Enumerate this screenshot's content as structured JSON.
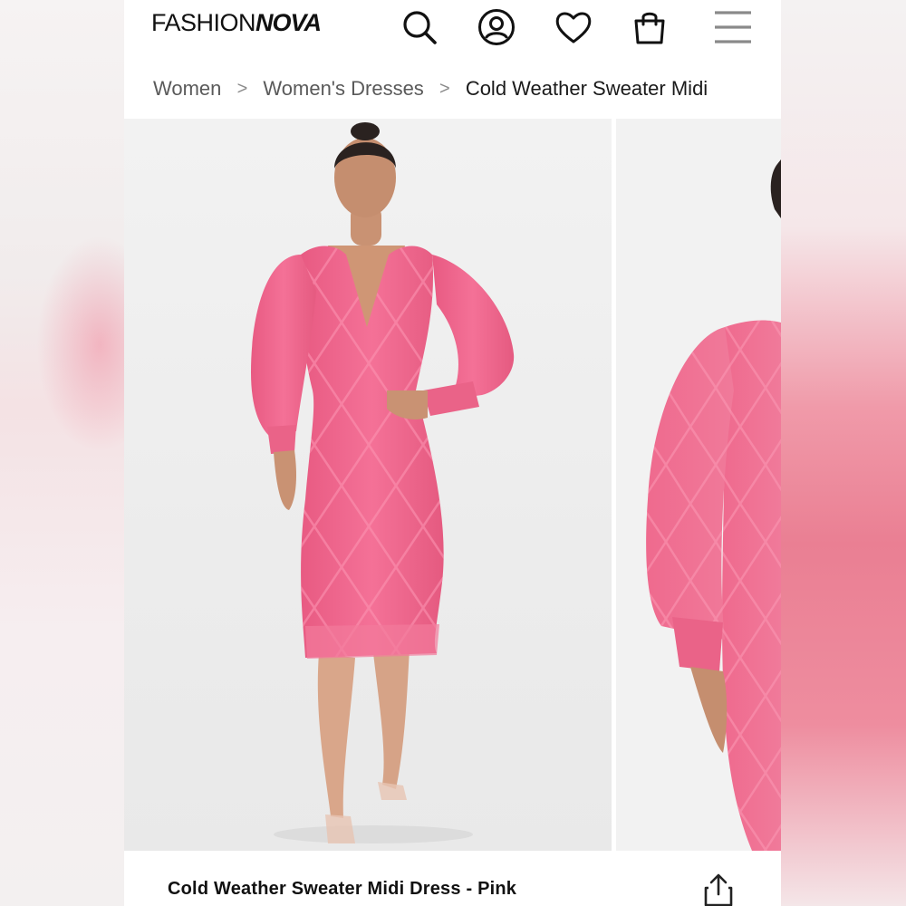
{
  "header": {
    "logo_light": "FASHION",
    "logo_bold": "NOVA",
    "icons": [
      "search-icon",
      "account-icon",
      "heart-icon",
      "bag-icon",
      "menu-icon"
    ]
  },
  "breadcrumb": {
    "items": [
      "Women",
      "Women's Dresses",
      "Cold Weather Sweater Midi"
    ],
    "separator": ">"
  },
  "product": {
    "title": "Cold Weather Sweater Midi Dress - Pink",
    "color": "#f06a8f"
  },
  "colors": {
    "dress_pink": "#f06a8f",
    "photo_bg": "#efefef"
  }
}
